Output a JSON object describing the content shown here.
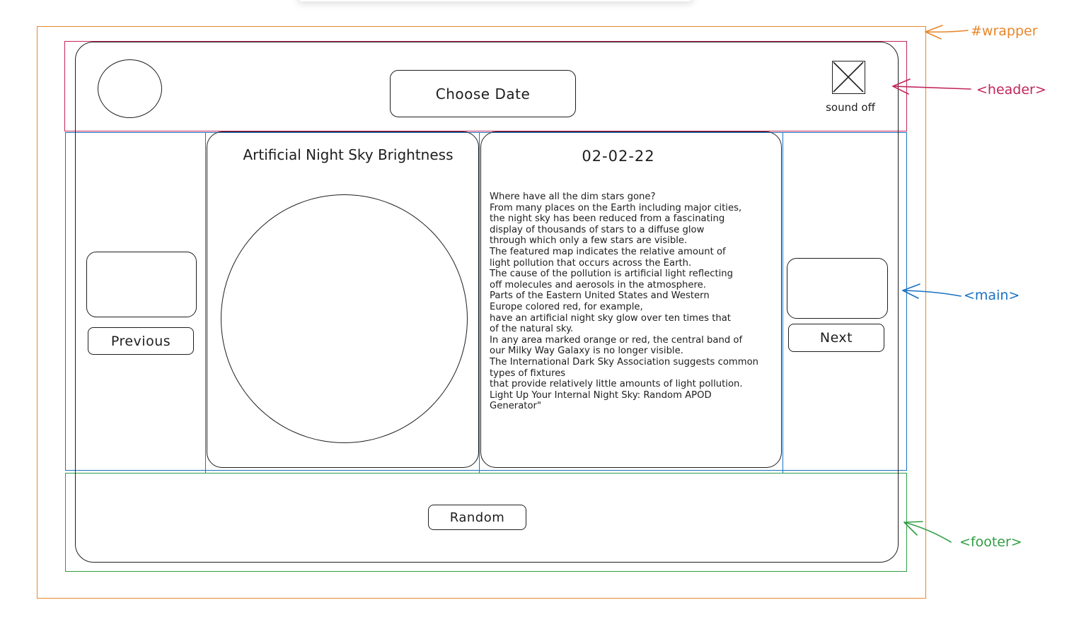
{
  "annotations": {
    "wrapper": "#wrapper",
    "header": "<header>",
    "main": "<main>",
    "footer": "<footer>"
  },
  "colors": {
    "wrapper": "#e8862a",
    "header": "#c2255c",
    "main": "#1971c2",
    "footer": "#2f9e44",
    "ink": "#1e1e1e"
  },
  "header": {
    "choose_date_label": "Choose Date",
    "sound_label": "sound off",
    "icons": [
      "logo-placeholder",
      "sound-toggle-placeholder"
    ]
  },
  "main": {
    "image_title": "Artificial Night Sky Brightness",
    "date": "02-02-22",
    "description_lines": [
      "Where have all the dim stars gone?",
      "From many places on the Earth including major cities,",
      "the night sky has been reduced from a fascinating",
      "display of thousands of stars to a diffuse glow",
      "through which only a few stars are visible.",
      "The featured map indicates the relative amount of",
      "light pollution that occurs across the Earth.",
      "The cause of the pollution is artificial light reflecting",
      "off molecules and aerosols in the atmosphere.",
      "Parts of the Eastern United States and Western",
      "Europe  colored red, for example,",
      "have an artificial night sky glow over ten times that",
      "of the natural sky.",
      "In any area marked orange or red, the central band of",
      "our Milky Way Galaxy is no longer visible.",
      "The International Dark Sky Association suggests common",
      "types of fixtures",
      "that provide relatively little amounts of light pollution.",
      "Light Up Your Internal Night Sky: Random APOD",
      "Generator\""
    ],
    "previous_label": "Previous",
    "next_label": "Next"
  },
  "footer": {
    "random_label": "Random"
  }
}
